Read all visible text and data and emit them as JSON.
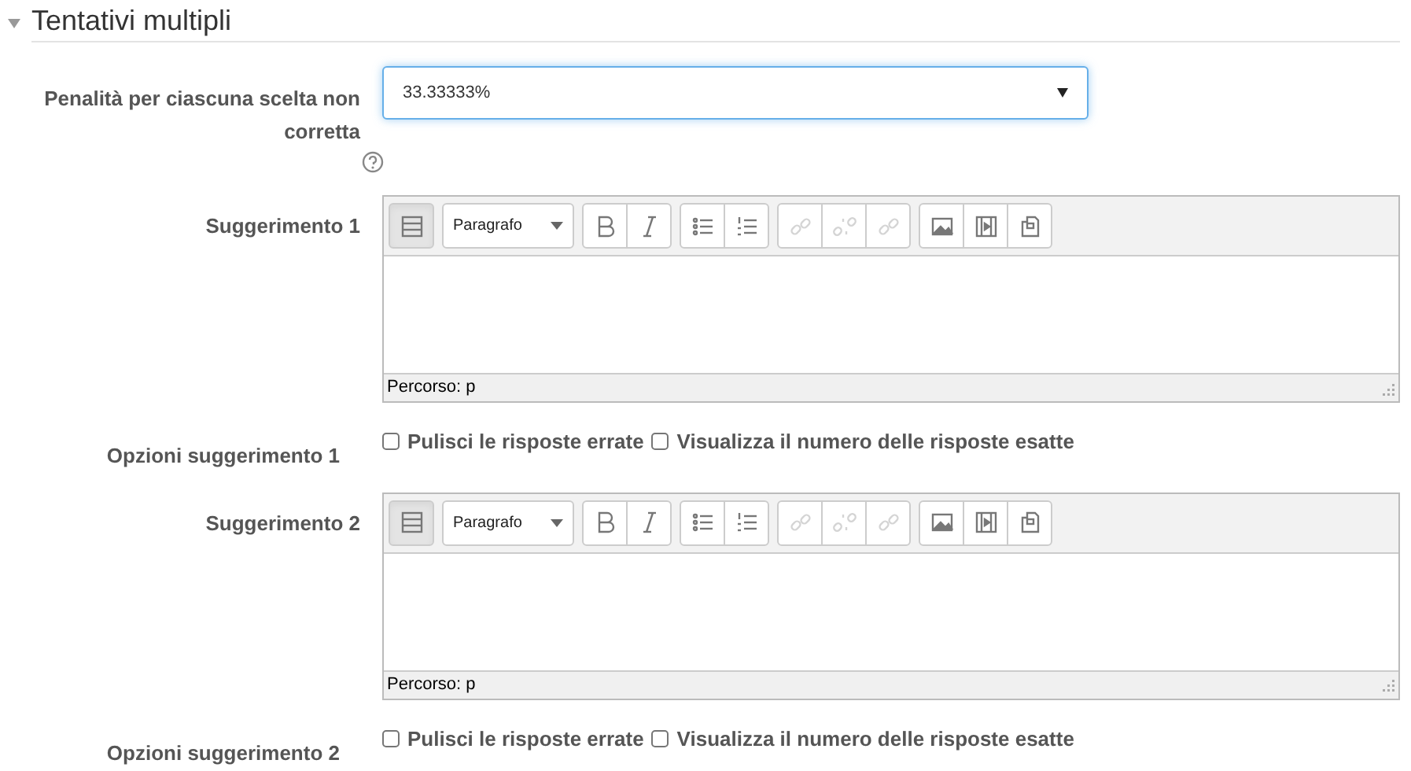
{
  "section": {
    "title": "Tentativi multipli",
    "expanded": true
  },
  "penalty": {
    "label": "Penalità per ciascuna scelta non corretta",
    "value": "33.33333%",
    "focused": true
  },
  "toolbar": [
    [
      {
        "kind": "collapse",
        "disabled": false,
        "selected": true
      }
    ],
    [
      {
        "kind": "format"
      }
    ],
    [
      {
        "kind": "bold",
        "disabled": false,
        "selected": false
      },
      {
        "kind": "italic",
        "disabled": false,
        "selected": false
      }
    ],
    [
      {
        "kind": "bullets",
        "disabled": false,
        "selected": false
      },
      {
        "kind": "numbers",
        "disabled": false,
        "selected": false
      }
    ],
    [
      {
        "kind": "link",
        "disabled": true,
        "selected": false
      },
      {
        "kind": "unlink",
        "disabled": true,
        "selected": false
      },
      {
        "kind": "anchor",
        "disabled": true,
        "selected": false
      }
    ],
    [
      {
        "kind": "image",
        "disabled": false,
        "selected": false
      },
      {
        "kind": "media",
        "disabled": false,
        "selected": false
      },
      {
        "kind": "files",
        "disabled": false,
        "selected": false
      }
    ]
  ],
  "hints": [
    {
      "label": "Suggerimento 1",
      "format": "Paragrafo",
      "path": "Percorso: p",
      "options_label": "Opzioni suggerimento 1",
      "options": [
        {
          "label": "Pulisci le risposte errate",
          "checked": false
        },
        {
          "label": "Visualizza il numero delle risposte esatte",
          "checked": false
        }
      ]
    },
    {
      "label": "Suggerimento 2",
      "format": "Paragrafo",
      "path": "Percorso: p",
      "options_label": "Opzioni suggerimento 2",
      "options": [
        {
          "label": "Pulisci le risposte errate",
          "checked": false
        },
        {
          "label": "Visualizza il numero delle risposte esatte",
          "checked": false
        }
      ]
    }
  ]
}
